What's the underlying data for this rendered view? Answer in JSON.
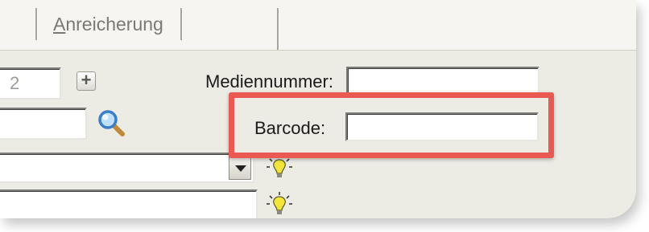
{
  "tabs": [
    {
      "label": "Anreicherung"
    }
  ],
  "form": {
    "number_value": "2",
    "plus_symbol": "+",
    "mediennummer_label": "Mediennummer:",
    "mediennummer_value": "",
    "barcode_label": "Barcode:",
    "barcode_value": "",
    "search_value": "",
    "dropdown_value": "",
    "text_value": ""
  },
  "icons": {
    "search": "magnifier-icon",
    "hint_1": "lightbulb-icon",
    "hint_2": "lightbulb-icon"
  },
  "colors": {
    "highlight": "#ea5a52",
    "panel_bg": "#ecebe4",
    "bulb": "#f2e43a"
  }
}
